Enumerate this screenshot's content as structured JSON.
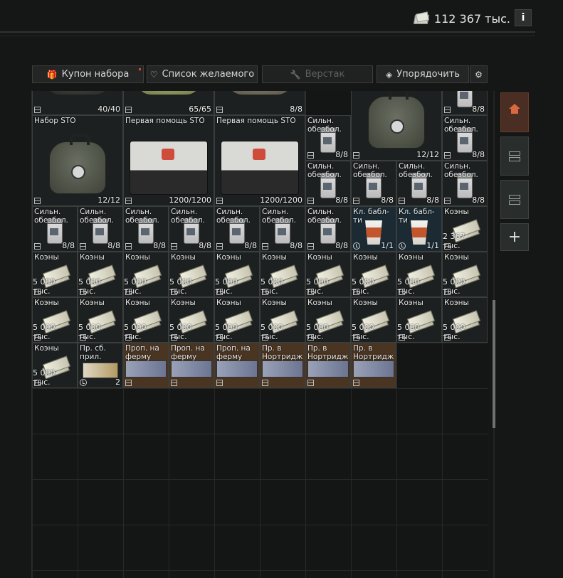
{
  "header": {
    "money": "112 367 тыс.",
    "info_label": "i"
  },
  "toolbar": {
    "kit_coupon": "Купон набора",
    "wishlist": "Список желаемого",
    "workbench": "Верстак",
    "sort": "Упорядочить"
  },
  "icons": {
    "gift": "🎁",
    "heart": "♡",
    "wrench": "🔧",
    "layers": "◈",
    "gear": "⚙"
  },
  "colors": {
    "active_side": "#d86a3f",
    "notification": "#e0442c"
  },
  "grid": {
    "items": [
      {
        "name": "",
        "count": "40/40",
        "img": "partial-bag"
      },
      {
        "name": "",
        "count": "65/65",
        "img": "partial-green"
      },
      {
        "name": "",
        "count": "8/8",
        "img": "partial-brown"
      },
      {
        "name": "",
        "count": "12/12",
        "img": "bag"
      },
      {
        "name": "",
        "count": "8/8",
        "img": "pills"
      },
      {
        "name": "Набор STO",
        "count": "12/12",
        "img": "bag"
      },
      {
        "name": "Первая помощь STO",
        "count": "1200/1200",
        "img": "kit"
      },
      {
        "name": "Первая помощь STO",
        "count": "1200/1200",
        "img": "kit"
      },
      {
        "name": "Сильн.\nобезбол.",
        "count": "8/8",
        "img": "pills"
      },
      {
        "name": "Сильн.\nобезбол.",
        "count": "8/8",
        "img": "pills"
      },
      {
        "name": "Сильн.\nобезбол.",
        "count": "8/8",
        "img": "pills"
      },
      {
        "name": "Сильн.\nобезбол.",
        "count": "8/8",
        "img": "pills"
      },
      {
        "name": "Сильн.\nобезбол.",
        "count": "8/8",
        "img": "pills"
      },
      {
        "name": "Сильн.\nобезбол.",
        "count": "8/8",
        "img": "pills"
      },
      {
        "name": "Сильн.\nобезбол.",
        "count": "8/8",
        "img": "pills"
      },
      {
        "name": "Сильн.\nобезбол.",
        "count": "8/8",
        "img": "pills"
      },
      {
        "name": "Сильн.\nобезбол.",
        "count": "8/8",
        "img": "pills"
      },
      {
        "name": "Сильн.\nобезбол.",
        "count": "8/8",
        "img": "pills"
      },
      {
        "name": "Сильн.\nобезбол.",
        "count": "8/8",
        "img": "pills"
      },
      {
        "name": "Сильн.\nобезбол.",
        "count": "8/8",
        "img": "pills"
      },
      {
        "name": "Сильн.\nобезбол.",
        "count": "8/8",
        "img": "pills"
      },
      {
        "name": "Кл. бабл-\nти",
        "count": "1/1",
        "img": "cup"
      },
      {
        "name": "Кл. бабл-\nти",
        "count": "1/1",
        "img": "cup"
      },
      {
        "name": "Коэны",
        "count": "2 367 тыс.",
        "img": "cash"
      },
      {
        "name": "Коэны",
        "count": "5 000 тыс.",
        "img": "cash"
      },
      {
        "name": "Коэны",
        "count": "5 000 тыс.",
        "img": "cash"
      },
      {
        "name": "Коэны",
        "count": "5 000 тыс.",
        "img": "cash"
      },
      {
        "name": "Коэны",
        "count": "5 000 тыс.",
        "img": "cash"
      },
      {
        "name": "Коэны",
        "count": "5 000 тыс.",
        "img": "cash"
      },
      {
        "name": "Коэны",
        "count": "5 000 тыс.",
        "img": "cash"
      },
      {
        "name": "Коэны",
        "count": "5 000 тыс.",
        "img": "cash"
      },
      {
        "name": "Коэны",
        "count": "5 000 тыс.",
        "img": "cash"
      },
      {
        "name": "Коэны",
        "count": "5 000 тыс.",
        "img": "cash"
      },
      {
        "name": "Коэны",
        "count": "5 000 тыс.",
        "img": "cash"
      },
      {
        "name": "Коэны",
        "count": "5 000 тыс.",
        "img": "cash"
      },
      {
        "name": "Коэны",
        "count": "5 000 тыс.",
        "img": "cash"
      },
      {
        "name": "Коэны",
        "count": "5 000 тыс.",
        "img": "cash"
      },
      {
        "name": "Коэны",
        "count": "5 000 тыс.",
        "img": "cash"
      },
      {
        "name": "Коэны",
        "count": "5 000 тыс.",
        "img": "cash"
      },
      {
        "name": "Коэны",
        "count": "5 000 тыс.",
        "img": "cash"
      },
      {
        "name": "Коэны",
        "count": "5 000 тыс.",
        "img": "cash"
      },
      {
        "name": "Коэны",
        "count": "5 000 тыс.",
        "img": "cash"
      },
      {
        "name": "Коэны",
        "count": "5 000 тыс.",
        "img": "cash"
      },
      {
        "name": "Коэны",
        "count": "5 000 тыс.",
        "img": "cash"
      },
      {
        "name": "Коэны",
        "count": "5 000 тыс.",
        "img": "cash"
      },
      {
        "name": "Пр. сб.\nприл.",
        "count": "2",
        "img": "goldcard"
      },
      {
        "name": "Проп. на\nферму",
        "count": "",
        "img": "card"
      },
      {
        "name": "Проп. на\nферму",
        "count": "",
        "img": "card"
      },
      {
        "name": "Проп. на\nферму",
        "count": "",
        "img": "card"
      },
      {
        "name": "Пр. в\nНортридж",
        "count": "",
        "img": "card"
      },
      {
        "name": "Пр. в\nНортридж",
        "count": "",
        "img": "card"
      },
      {
        "name": "Пр. в\nНортридж",
        "count": "",
        "img": "card"
      }
    ]
  },
  "side": {
    "add_label": "+"
  }
}
